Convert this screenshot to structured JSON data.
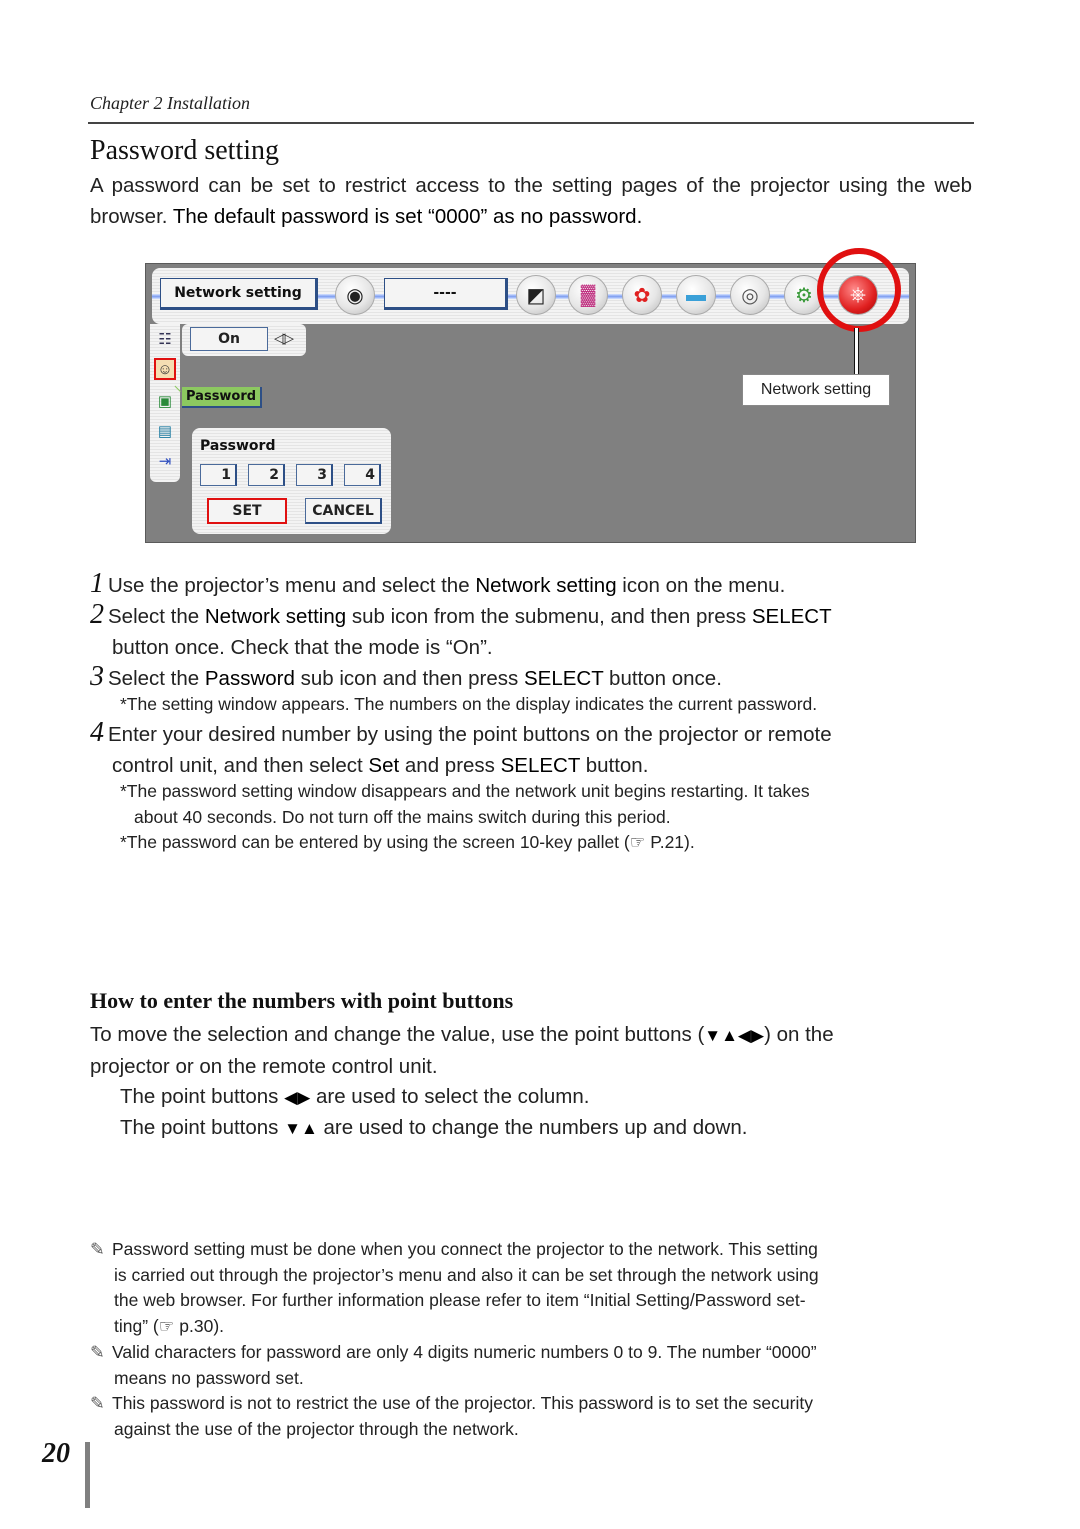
{
  "header": {
    "chapter": "Chapter 2 Installation"
  },
  "section": {
    "title": "Password setting",
    "intro_plain": "A password can be set to restrict access to the setting pages of the projector using the web browser. ",
    "intro_strong": "The default password is set “0000” as no password."
  },
  "screenshot": {
    "topbar_title": "Network setting",
    "topbar_value": "----",
    "menu_icons": [
      {
        "name": "input-icon",
        "glyph": "◉"
      },
      {
        "name": "pc-adjust-icon",
        "glyph": "◩"
      },
      {
        "name": "image-select-icon",
        "glyph": "▓"
      },
      {
        "name": "image-adjust-icon",
        "glyph": "✿"
      },
      {
        "name": "screen-icon",
        "glyph": "▬"
      },
      {
        "name": "sound-icon",
        "glyph": "◎"
      },
      {
        "name": "setting-icon",
        "glyph": "⚙"
      },
      {
        "name": "network-setting-icon",
        "glyph": "⎈"
      }
    ],
    "callout_label": "Network setting",
    "mode_value": "On",
    "mode_arrows": "◁▷",
    "sidebar_icons": [
      {
        "name": "network-icon",
        "glyph": "☷"
      },
      {
        "name": "password-icon",
        "glyph": "☺"
      },
      {
        "name": "image-capture-icon",
        "glyph": "▣"
      },
      {
        "name": "network-info-icon",
        "glyph": "▤"
      },
      {
        "name": "exit-icon",
        "glyph": "⇥"
      }
    ],
    "tooltip": "Password",
    "dialog_title": "Password",
    "digits": [
      "1",
      "2",
      "3",
      "4"
    ],
    "set_label": "SET",
    "cancel_label": "CANCEL"
  },
  "steps": [
    {
      "num": "1",
      "parts": [
        [
          "Use the projector’s menu and select the ",
          false
        ],
        [
          "Network setting",
          true
        ],
        [
          " icon on the menu.",
          false
        ]
      ]
    },
    {
      "num": "2",
      "line1": [
        [
          "Select the ",
          false
        ],
        [
          "Network setting",
          true
        ],
        [
          " sub icon from the submenu, and then press ",
          false
        ],
        [
          "SELECT",
          true
        ]
      ],
      "line2": "button once. Check that the mode is “On”."
    },
    {
      "num": "3",
      "parts": [
        [
          "Select the ",
          false
        ],
        [
          "Password",
          true
        ],
        [
          " sub icon and then press ",
          false
        ],
        [
          "SELECT",
          true
        ],
        [
          " button once.",
          false
        ]
      ]
    },
    {
      "num": "4",
      "line1": "Enter your desired number by using the point buttons on the projector or remote",
      "line2": [
        [
          "control unit, and then select ",
          false
        ],
        [
          "Set",
          true
        ],
        [
          " and press ",
          false
        ],
        [
          "SELECT",
          true
        ],
        [
          " button.",
          false
        ]
      ]
    }
  ],
  "notes": {
    "step3": "*The setting window appears. The numbers on the display indicates the current password.",
    "step4a_line1": "*The password setting window disappears and the network unit begins restarting. It takes",
    "step4a_line2": "about 40 seconds. Do not turn off the mains switch during this period.",
    "step4b": "*The password can be entered by using the screen 10-key pallet (☞ P.21)."
  },
  "point_buttons": {
    "heading": "How to enter the numbers with point buttons",
    "intro_a": "To move the selection and change the value, use the point buttons (",
    "intro_glyphs": "▼▲◀▶",
    "intro_b": ") on the",
    "intro_line2": "projector or on the remote control unit.",
    "line1_a": "The point buttons ",
    "line1_glyphs": "◀▶",
    "line1_b": " are used to select the column.",
    "line2_a": "The point buttons ",
    "line2_glyphs": "▼▲",
    "line2_b": "  are used to change the numbers up and down."
  },
  "tips": [
    {
      "lines": [
        "Password setting must be done when you connect the projector to the network. This setting",
        "is carried out through the projector’s menu and also it can be set through the network using",
        "the web browser. For further information please refer to item “Initial Setting/Password set-",
        "ting” (☞ p.30)."
      ]
    },
    {
      "lines": [
        "Valid characters for password are only 4 digits numeric numbers 0 to 9. The number “0000”",
        "means no password set."
      ]
    },
    {
      "lines": [
        "This password is not to restrict the use of the projector. This password is to set the security",
        "against the use of the projector through the network."
      ]
    }
  ],
  "tip_icon": "✎",
  "footer": {
    "page_number": "20"
  }
}
